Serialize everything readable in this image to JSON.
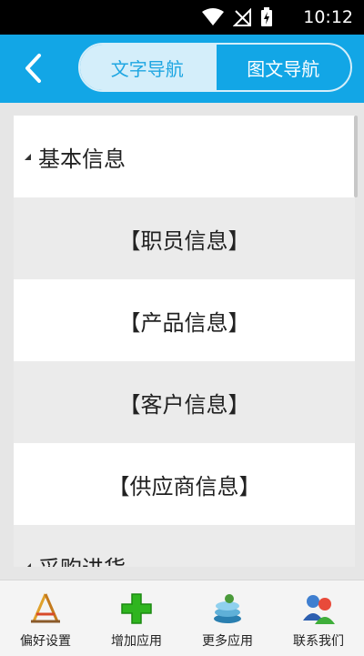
{
  "status": {
    "time": "10:12"
  },
  "header": {
    "back_icon": "chevron-left-icon",
    "tabs": [
      {
        "label": "文字导航",
        "active": true
      },
      {
        "label": "图文导航",
        "active": false
      }
    ]
  },
  "list": {
    "group1": {
      "label": "基本信息"
    },
    "items": [
      {
        "label": "【职员信息】"
      },
      {
        "label": "【产品信息】"
      },
      {
        "label": "【客户信息】"
      },
      {
        "label": "【供应商信息】"
      }
    ],
    "group2": {
      "label": "采购进货"
    }
  },
  "bottom_nav": [
    {
      "label": "偏好设置",
      "icon": "settings-tools-icon"
    },
    {
      "label": "增加应用",
      "icon": "plus-icon"
    },
    {
      "label": "更多应用",
      "icon": "apps-stack-icon"
    },
    {
      "label": "联系我们",
      "icon": "contacts-people-icon"
    }
  ],
  "colors": {
    "header": "#12a6e6",
    "tab_active_bg": "#d4eefa",
    "tab_active_text": "#1ea6e2"
  }
}
